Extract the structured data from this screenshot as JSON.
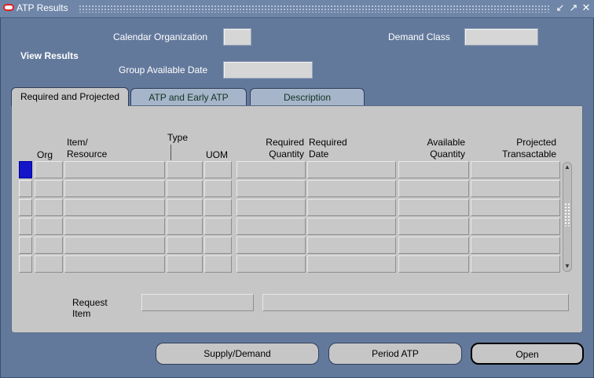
{
  "window": {
    "title": "ATP Results"
  },
  "header": {
    "calendar_org_label": "Calendar Organization",
    "calendar_org_value": "",
    "demand_class_label": "Demand Class",
    "demand_class_value": "",
    "view_results_label": "View Results",
    "group_available_date_label": "Group Available Date",
    "group_available_date_value": ""
  },
  "tabs": [
    {
      "label": "Required and Projected",
      "active": true
    },
    {
      "label": "ATP and Early ATP",
      "active": false
    },
    {
      "label": "Description",
      "active": false
    }
  ],
  "table": {
    "columns": {
      "org": "Org",
      "item_line1": "Item/",
      "item_line2": "Resource",
      "type": "Type",
      "uom": "UOM",
      "req_qty_line1": "Required",
      "req_qty_line2": "Quantity",
      "req_date_line1": "Required",
      "req_date_line2": "Date",
      "avail_qty_line1": "Available",
      "avail_qty_line2": "Quantity",
      "proj_line1": "Projected",
      "proj_line2": "Transactable"
    },
    "row_count": 6
  },
  "request_item": {
    "label": "Request Item",
    "value": "",
    "description": ""
  },
  "buttons": {
    "supply_demand": "Supply/Demand",
    "period_atp": "Period ATP",
    "open": "Open"
  },
  "colors": {
    "window_bg": "#63799c",
    "panel_bg": "#c6c6c6",
    "current_record": "#1414c8"
  }
}
